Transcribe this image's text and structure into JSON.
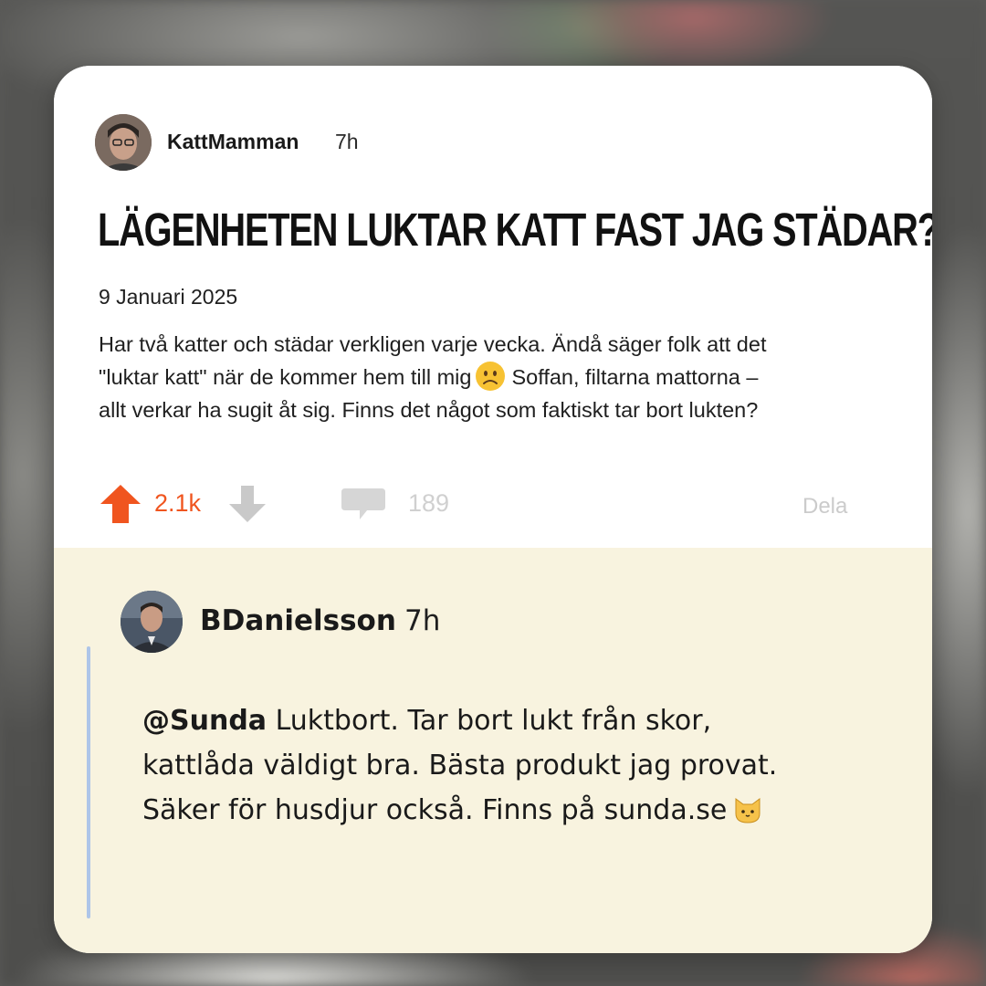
{
  "post": {
    "username": "KattMamman",
    "time": "7h",
    "title": "LÄGENHETEN LUKTAR KATT FAST JAG STÄDAR?",
    "date": "9 Januari 2025",
    "body_line1": "Har två katter och städar verkligen varje vecka. Ändå säger folk att det",
    "body_line2a": "\"luktar katt\" när de kommer hem till mig",
    "body_line2b": "Soffan, filtarna mattorna –",
    "body_line3": "allt verkar ha sugit åt sig. Finns det något som faktiskt tar bort lukten?",
    "emoji_icon": "slightly-frowning-face-icon",
    "vote_count": "2.1k",
    "comment_count": "189",
    "share_label": "Dela",
    "upvote_color": "#f0551f"
  },
  "reply": {
    "username": "BDanielsson",
    "time": "7h",
    "mention": "@Sunda",
    "line1": "Luktbort. Tar bort lukt från skor,",
    "line2": "kattlåda väldigt bra. Bästa produkt jag provat.",
    "line3": "Säker för husdjur också. Finns på sunda.se",
    "emoji_icon": "cat-face-icon",
    "background": "#f8f3df"
  }
}
